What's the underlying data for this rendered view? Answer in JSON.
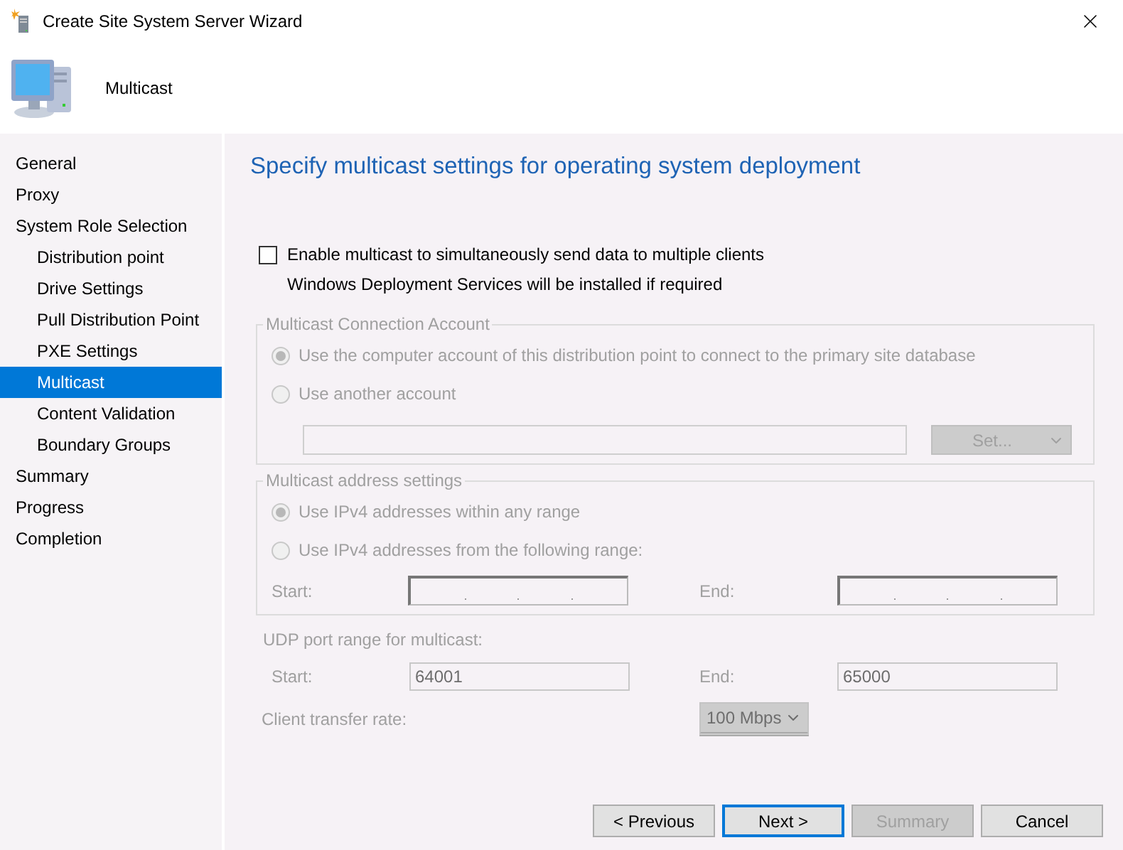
{
  "window": {
    "title": "Create Site System Server Wizard"
  },
  "header": {
    "title": "Multicast"
  },
  "sidebar": {
    "items": [
      {
        "label": "General",
        "selected": false
      },
      {
        "label": "Proxy",
        "selected": false
      },
      {
        "label": "System Role Selection",
        "selected": false,
        "children": [
          {
            "label": "Distribution point",
            "selected": false
          },
          {
            "label": "Drive Settings",
            "selected": false
          },
          {
            "label": "Pull Distribution Point",
            "selected": false
          },
          {
            "label": "PXE Settings",
            "selected": false
          },
          {
            "label": "Multicast",
            "selected": true
          },
          {
            "label": "Content Validation",
            "selected": false
          },
          {
            "label": "Boundary Groups",
            "selected": false
          }
        ]
      },
      {
        "label": "Summary",
        "selected": false
      },
      {
        "label": "Progress",
        "selected": false
      },
      {
        "label": "Completion",
        "selected": false
      }
    ]
  },
  "page": {
    "heading": "Specify multicast settings for operating system deployment",
    "enable": {
      "label": "Enable multicast to simultaneously send data to multiple clients",
      "checked": false
    },
    "note": "Windows Deployment Services will be installed if required",
    "settings_disabled": true,
    "account_group": {
      "title": "Multicast Connection Account",
      "options": [
        {
          "label": "Use the computer account of this distribution point to connect to the primary site database",
          "selected": true
        },
        {
          "label": "Use another account",
          "selected": false
        }
      ],
      "set_button": "Set..."
    },
    "address_group": {
      "title": "Multicast address settings",
      "options": [
        {
          "label": "Use IPv4 addresses within any range",
          "selected": true
        },
        {
          "label": "Use IPv4 addresses from the following range:",
          "selected": false
        }
      ],
      "start_label": "Start:",
      "end_label": "End:"
    },
    "udp": {
      "title": "UDP port range for multicast:",
      "start_label": "Start:",
      "start_value": "64001",
      "end_label": "End:",
      "end_value": "65000"
    },
    "transfer": {
      "label": "Client transfer rate:",
      "value": "100 Mbps"
    }
  },
  "buttons": [
    {
      "label": "< Previous",
      "kind": "normal"
    },
    {
      "label": "Next >",
      "kind": "default"
    },
    {
      "label": "Summary",
      "kind": "disabled"
    },
    {
      "label": "Cancel",
      "kind": "normal"
    }
  ]
}
